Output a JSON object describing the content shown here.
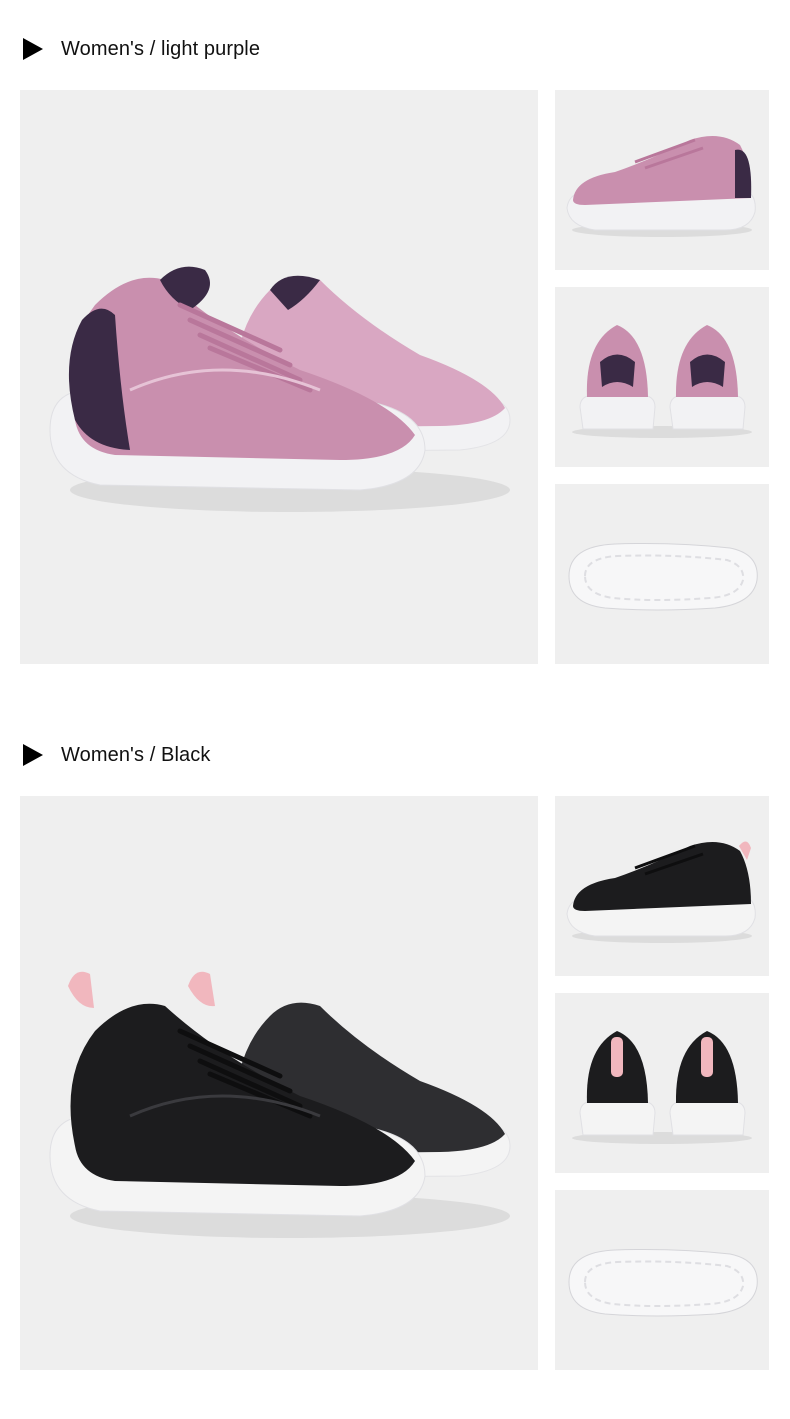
{
  "sections": [
    {
      "title": "Women's / light purple",
      "colors": {
        "upper": "#c98fae",
        "upper_light": "#d9a7c2",
        "accent": "#3a2a45",
        "laces": "#b9779b",
        "sole": "#f2f2f4"
      },
      "images": [
        "sneaker-pair-angle-icon",
        "sneaker-side-icon",
        "sneaker-back-pair-icon",
        "sneaker-sole-icon"
      ]
    },
    {
      "title": "Women's / Black",
      "colors": {
        "upper": "#1c1c1e",
        "upper_light": "#2e2e31",
        "accent": "#f1b7be",
        "laces": "#0e0e0f",
        "sole": "#f4f4f4"
      },
      "images": [
        "sneaker-pair-angle-icon",
        "sneaker-side-icon",
        "sneaker-back-pair-icon",
        "sneaker-sole-icon"
      ]
    }
  ]
}
